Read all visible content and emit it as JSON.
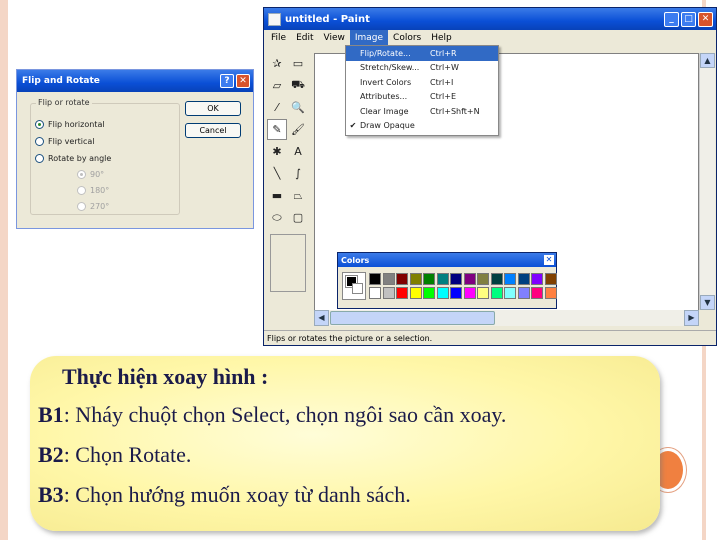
{
  "paint": {
    "title": "untitled - Paint",
    "menus": [
      "File",
      "Edit",
      "View",
      "Image",
      "Colors",
      "Help"
    ],
    "active_menu": "Image",
    "image_menu": [
      {
        "label": "Flip/Rotate...",
        "shortcut": "Ctrl+R",
        "highlighted": true,
        "checked": false
      },
      {
        "label": "Stretch/Skew...",
        "shortcut": "Ctrl+W",
        "highlighted": false,
        "checked": false
      },
      {
        "label": "Invert Colors",
        "shortcut": "Ctrl+I",
        "highlighted": false,
        "checked": false
      },
      {
        "label": "Attributes...",
        "shortcut": "Ctrl+E",
        "highlighted": false,
        "checked": false
      },
      {
        "label": "Clear Image",
        "shortcut": "Ctrl+Shft+N",
        "highlighted": false,
        "checked": false
      },
      {
        "label": "Draw Opaque",
        "shortcut": "",
        "highlighted": false,
        "checked": true
      }
    ],
    "status": "Flips or rotates the picture or a selection.",
    "tools": [
      {
        "name": "free-form-select-icon",
        "glyph": "✰"
      },
      {
        "name": "select-icon",
        "glyph": "▭"
      },
      {
        "name": "eraser-icon",
        "glyph": "▱"
      },
      {
        "name": "fill-bucket-icon",
        "glyph": "⛟"
      },
      {
        "name": "color-picker-icon",
        "glyph": "⁄"
      },
      {
        "name": "magnifier-icon",
        "glyph": "🔍"
      },
      {
        "name": "pencil-icon",
        "glyph": "✎"
      },
      {
        "name": "brush-icon",
        "glyph": "🖌"
      },
      {
        "name": "airbrush-icon",
        "glyph": "✱"
      },
      {
        "name": "text-icon",
        "glyph": "A"
      },
      {
        "name": "line-icon",
        "glyph": "╲"
      },
      {
        "name": "curve-icon",
        "glyph": "∫"
      },
      {
        "name": "rectangle-icon",
        "glyph": "▬"
      },
      {
        "name": "polygon-icon",
        "glyph": "⏢"
      },
      {
        "name": "ellipse-icon",
        "glyph": "⬭"
      },
      {
        "name": "rounded-rectangle-icon",
        "glyph": "▢"
      }
    ],
    "pressed_tool": 6
  },
  "colors_box": {
    "title": "Colors",
    "close_glyph": "✕",
    "foreground": "#000000",
    "background": "#ffffff",
    "palette_row1": [
      "#000000",
      "#808080",
      "#800000",
      "#808000",
      "#008000",
      "#008080",
      "#000080",
      "#800080",
      "#808040",
      "#004040",
      "#0080ff",
      "#004080",
      "#8000ff",
      "#804000"
    ],
    "palette_row2": [
      "#ffffff",
      "#c0c0c0",
      "#ff0000",
      "#ffff00",
      "#00ff00",
      "#00ffff",
      "#0000ff",
      "#ff00ff",
      "#ffff80",
      "#00ff80",
      "#80ffff",
      "#8080ff",
      "#ff0080",
      "#ff8040"
    ]
  },
  "dialog": {
    "title": "Flip and Rotate",
    "group_label": "Flip or rotate",
    "options": [
      "Flip horizontal",
      "Flip vertical",
      "Rotate by angle"
    ],
    "selected_option": 0,
    "angles": [
      "90°",
      "180°",
      "270°"
    ],
    "selected_angle": 0,
    "ok_label": "OK",
    "cancel_label": "Cancel",
    "help_glyph": "?",
    "close_glyph": "✕"
  },
  "note": {
    "heading": "Thực hiện xoay hình :",
    "steps": [
      {
        "label": "B1",
        "text": ": Nháy chuột chọn Select, chọn ngôi sao cần xoay."
      },
      {
        "label": "B2",
        "text": ": Chọn Rotate."
      },
      {
        "label": "B3",
        "text": ": Chọn hướng muốn xoay từ danh sách."
      }
    ]
  },
  "accent": "#f08040"
}
